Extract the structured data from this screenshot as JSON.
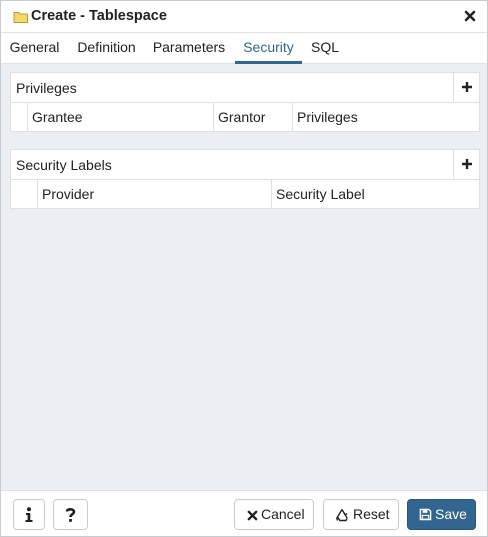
{
  "dialog": {
    "title": "Create - Tablespace",
    "icons": {
      "title": "folder-icon",
      "close": "close-icon"
    }
  },
  "tabs": [
    {
      "label": "General",
      "active": false
    },
    {
      "label": "Definition",
      "active": false
    },
    {
      "label": "Parameters",
      "active": false
    },
    {
      "label": "Security",
      "active": true
    },
    {
      "label": "SQL",
      "active": false
    }
  ],
  "privileges": {
    "title": "Privileges",
    "columns": [
      "",
      "Grantee",
      "Grantor",
      "Privileges"
    ],
    "add_icon": "plus-icon"
  },
  "security_labels": {
    "title": "Security Labels",
    "columns": [
      "",
      "Provider",
      "Security Label"
    ],
    "add_icon": "plus-icon"
  },
  "footer": {
    "info_icon": "info-icon",
    "help_icon": "question-icon",
    "cancel_label": "Cancel",
    "reset_label": "Reset",
    "save_label": "Save"
  },
  "colors": {
    "accent": "#326690",
    "content_background": "#ebeef3",
    "border": "#dde0e6",
    "folder_icon": "#f5d76e"
  }
}
